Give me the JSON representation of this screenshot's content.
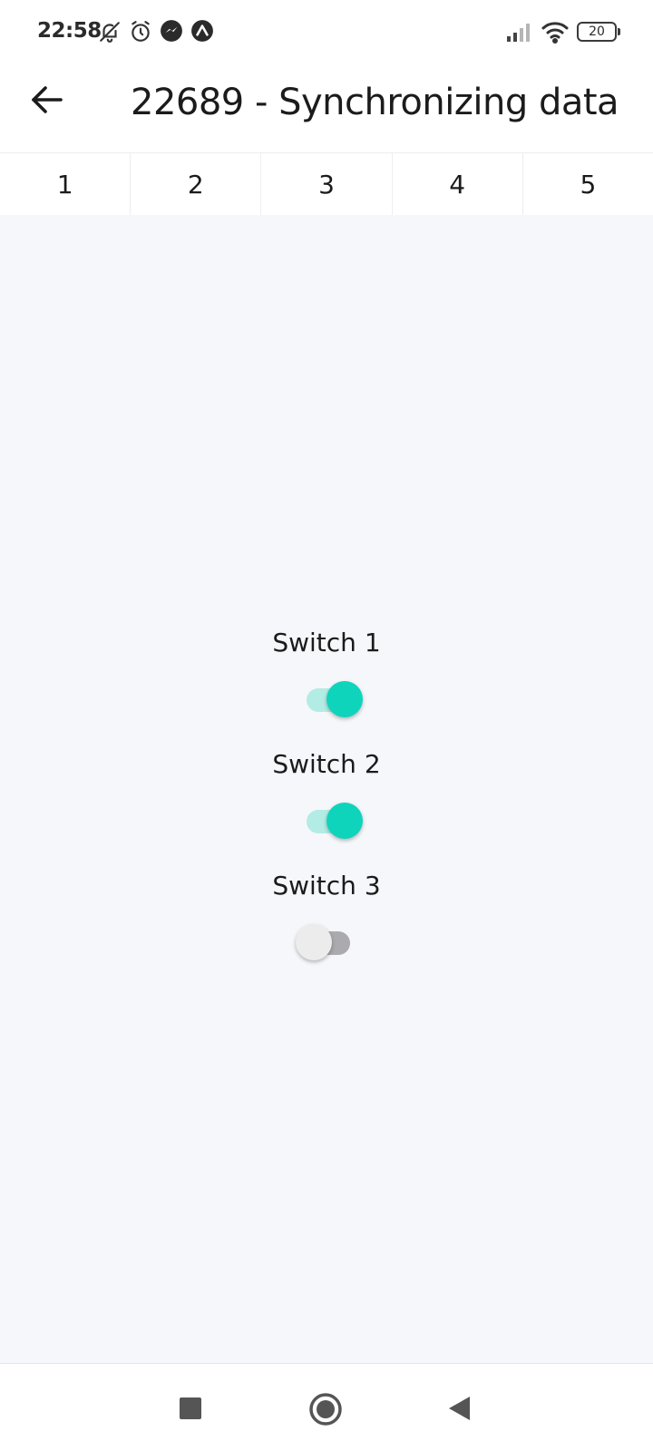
{
  "status_bar": {
    "time": "22:58",
    "icons": [
      "bell-off-icon",
      "alarm-icon",
      "messenger-icon",
      "app-icon",
      "signal-icon",
      "wifi-icon"
    ],
    "battery": "20"
  },
  "app_bar": {
    "back_icon": "arrow-left-icon",
    "title": "22689 - Synchronizing data"
  },
  "tabs": [
    {
      "label": "1"
    },
    {
      "label": "2"
    },
    {
      "label": "3"
    },
    {
      "label": "4"
    },
    {
      "label": "5"
    }
  ],
  "switches": [
    {
      "label": "Switch 1",
      "on": true
    },
    {
      "label": "Switch 2",
      "on": true
    },
    {
      "label": "Switch 3",
      "on": false
    }
  ],
  "colors": {
    "accent": "#0fd4bc",
    "accent_track": "#b2ece5",
    "off_track": "#aaaaaf",
    "off_thumb": "#ececec",
    "background": "#f6f7fb"
  },
  "nav_bar": {
    "icons": [
      "square-recents-icon",
      "circle-home-icon",
      "triangle-back-icon"
    ]
  }
}
